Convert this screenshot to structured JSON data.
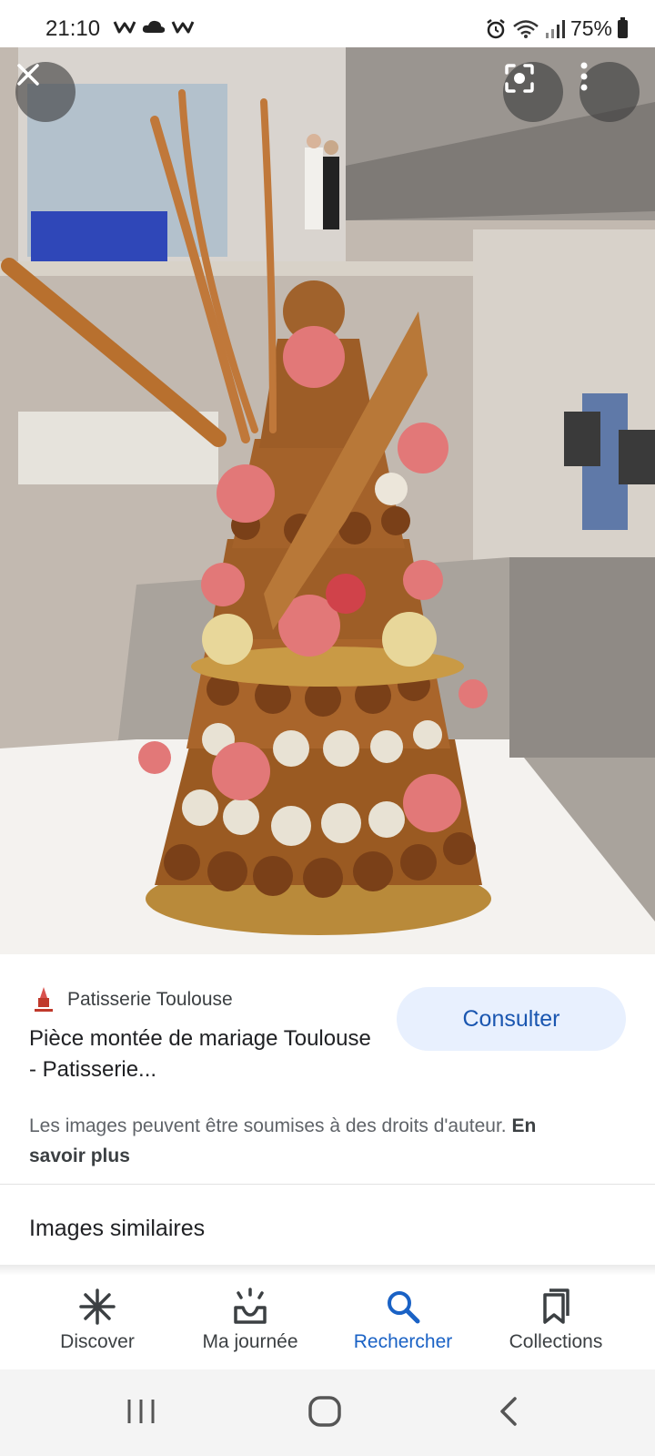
{
  "status_bar": {
    "time": "21:10",
    "notification_icons": [
      "w-app-icon",
      "cloud-icon",
      "w-app-icon"
    ],
    "battery": "75%"
  },
  "image_viewer": {
    "close_icon": "close-icon",
    "lens_icon": "lens-icon",
    "more_icon": "more-vert-icon"
  },
  "result": {
    "source_name": "Patisserie Toulouse",
    "title": "Pièce montée de mariage Toulouse - Patisserie...",
    "visit_button": "Consulter",
    "rights_text": "Les images peuvent être soumises à des droits d'auteur.",
    "rights_link": "En savoir plus"
  },
  "similar_heading": "Images similaires",
  "bottom_nav": {
    "items": [
      {
        "label": "Discover",
        "icon": "asterisk-icon"
      },
      {
        "label": "Ma journée",
        "icon": "sunrise-icon"
      },
      {
        "label": "Rechercher",
        "icon": "search-icon"
      },
      {
        "label": "Collections",
        "icon": "bookmark-stack-icon"
      }
    ],
    "active_color": "#1a62c5"
  }
}
